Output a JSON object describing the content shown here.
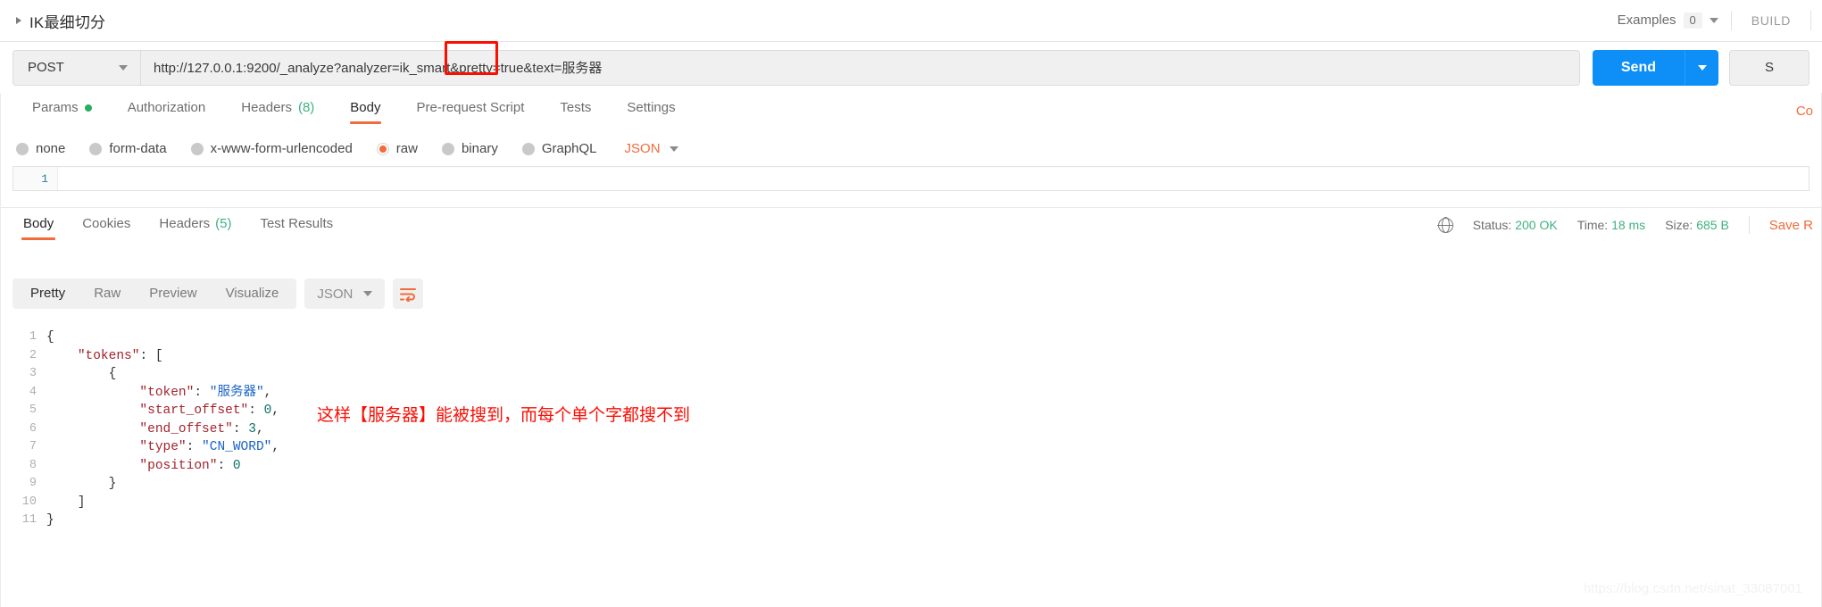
{
  "header": {
    "request_title": "IK最细切分",
    "expand_icon": "caret-right-icon",
    "examples_label": "Examples",
    "examples_count": "0",
    "examples_caret": "chevron-down-icon",
    "build_label": "BUILD"
  },
  "url_bar": {
    "method": "POST",
    "method_caret": "chevron-down-icon",
    "url": "http://127.0.0.1:9200/_analyze?analyzer=ik_smart&pretty=true&text=服务器",
    "send_label": "Send",
    "send_caret": "chevron-down-icon",
    "save_label": "S",
    "highlight_color": "#fa0f00"
  },
  "request_tabs": {
    "items": [
      {
        "label": "Params",
        "badge": "",
        "dot": true,
        "active": false
      },
      {
        "label": "Authorization",
        "badge": "",
        "dot": false,
        "active": false
      },
      {
        "label": "Headers",
        "badge": "(8)",
        "dot": false,
        "active": false
      },
      {
        "label": "Body",
        "badge": "",
        "dot": false,
        "active": true
      },
      {
        "label": "Pre-request Script",
        "badge": "",
        "dot": false,
        "active": false
      },
      {
        "label": "Tests",
        "badge": "",
        "dot": false,
        "active": false
      },
      {
        "label": "Settings",
        "badge": "",
        "dot": false,
        "active": false
      }
    ],
    "code_link": "Co"
  },
  "body_types": {
    "options": [
      {
        "label": "none",
        "selected": false
      },
      {
        "label": "form-data",
        "selected": false
      },
      {
        "label": "x-www-form-urlencoded",
        "selected": false
      },
      {
        "label": "raw",
        "selected": true
      },
      {
        "label": "binary",
        "selected": false
      },
      {
        "label": "GraphQL",
        "selected": false
      }
    ],
    "format": "JSON",
    "format_caret": "chevron-down-icon",
    "accent_color": "#f26b3a"
  },
  "body_editor": {
    "line_number": "1",
    "content": ""
  },
  "response_tabs": {
    "items": [
      {
        "label": "Body",
        "badge": "",
        "active": true
      },
      {
        "label": "Cookies",
        "badge": "",
        "active": false
      },
      {
        "label": "Headers",
        "badge": "(5)",
        "active": false
      },
      {
        "label": "Test Results",
        "badge": "",
        "active": false
      }
    ],
    "globe_icon": "globe-icon",
    "status_label": "Status:",
    "status_value": "200 OK",
    "time_label": "Time:",
    "time_value": "18 ms",
    "size_label": "Size:",
    "size_value": "685 B",
    "save_response": "Save R"
  },
  "response_toolbar": {
    "views": [
      {
        "label": "Pretty",
        "active": true
      },
      {
        "label": "Raw",
        "active": false
      },
      {
        "label": "Preview",
        "active": false
      },
      {
        "label": "Visualize",
        "active": false
      }
    ],
    "format": "JSON",
    "format_caret": "chevron-down-icon",
    "wrap_icon": "text-wrap-icon"
  },
  "response_body": {
    "lines": [
      {
        "n": "1",
        "segments": [
          {
            "t": "{",
            "c": "k-punct"
          }
        ]
      },
      {
        "n": "2",
        "segments": [
          {
            "t": "    ",
            "c": "k-punct"
          },
          {
            "t": "\"tokens\"",
            "c": "k-key"
          },
          {
            "t": ": [",
            "c": "k-punct"
          }
        ]
      },
      {
        "n": "3",
        "segments": [
          {
            "t": "        {",
            "c": "k-punct"
          }
        ]
      },
      {
        "n": "4",
        "segments": [
          {
            "t": "            ",
            "c": "k-punct"
          },
          {
            "t": "\"token\"",
            "c": "k-key"
          },
          {
            "t": ": ",
            "c": "k-punct"
          },
          {
            "t": "\"服务器\"",
            "c": "k-str"
          },
          {
            "t": ",",
            "c": "k-punct"
          }
        ]
      },
      {
        "n": "5",
        "segments": [
          {
            "t": "            ",
            "c": "k-punct"
          },
          {
            "t": "\"start_offset\"",
            "c": "k-key"
          },
          {
            "t": ": ",
            "c": "k-punct"
          },
          {
            "t": "0",
            "c": "k-num"
          },
          {
            "t": ",",
            "c": "k-punct"
          }
        ]
      },
      {
        "n": "6",
        "segments": [
          {
            "t": "            ",
            "c": "k-punct"
          },
          {
            "t": "\"end_offset\"",
            "c": "k-key"
          },
          {
            "t": ": ",
            "c": "k-punct"
          },
          {
            "t": "3",
            "c": "k-num"
          },
          {
            "t": ",",
            "c": "k-punct"
          }
        ]
      },
      {
        "n": "7",
        "segments": [
          {
            "t": "            ",
            "c": "k-punct"
          },
          {
            "t": "\"type\"",
            "c": "k-key"
          },
          {
            "t": ": ",
            "c": "k-punct"
          },
          {
            "t": "\"CN_WORD\"",
            "c": "k-str"
          },
          {
            "t": ",",
            "c": "k-punct"
          }
        ]
      },
      {
        "n": "8",
        "segments": [
          {
            "t": "            ",
            "c": "k-punct"
          },
          {
            "t": "\"position\"",
            "c": "k-key"
          },
          {
            "t": ": ",
            "c": "k-punct"
          },
          {
            "t": "0",
            "c": "k-num"
          }
        ]
      },
      {
        "n": "9",
        "segments": [
          {
            "t": "        }",
            "c": "k-punct"
          }
        ]
      },
      {
        "n": "10",
        "segments": [
          {
            "t": "    ]",
            "c": "k-punct"
          }
        ]
      },
      {
        "n": "11",
        "segments": [
          {
            "t": "}",
            "c": "k-punct"
          }
        ]
      }
    ]
  },
  "annotation": {
    "text": "这样【服务器】能被搜到，而每个单个字都搜不到",
    "color": "#fb0e04"
  },
  "watermark": {
    "text": "https://blog.csdn.net/sinat_33087001"
  }
}
